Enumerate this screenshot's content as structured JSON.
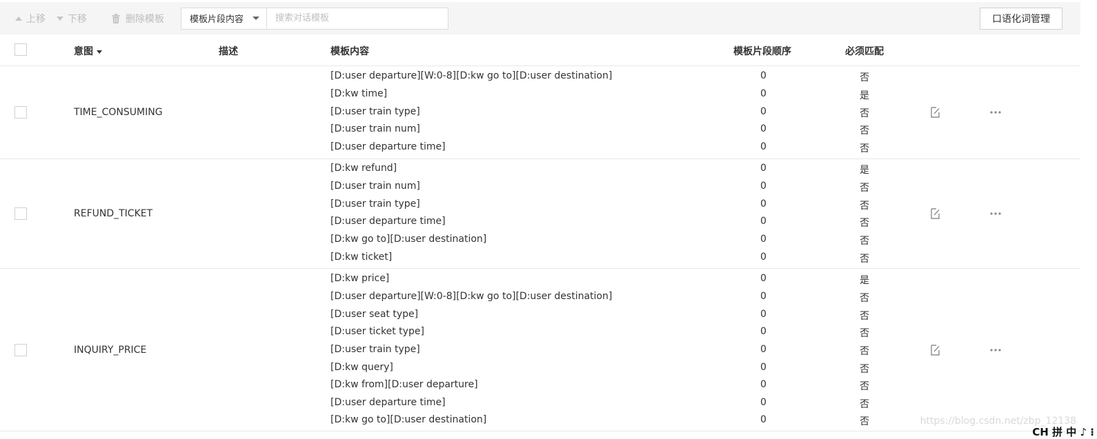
{
  "toolbar": {
    "up_label": "上移",
    "down_label": "下移",
    "delete_label": "删除模板",
    "search_field_selected": "模板片段内容",
    "search_placeholder": "搜索对话模板",
    "oral_button": "口语化词管理"
  },
  "table": {
    "headers": {
      "intent": "意图",
      "description": "描述",
      "content": "模板内容",
      "order": "模板片段顺序",
      "must_match": "必须匹配"
    },
    "groups": [
      {
        "intent": "TIME_CONSUMING",
        "segments": [
          {
            "content": "[D:user departure][W:0-8][D:kw go to][D:user destination]",
            "order": "0",
            "must": "否"
          },
          {
            "content": "[D:kw time]",
            "order": "0",
            "must": "是"
          },
          {
            "content": "[D:user train type]",
            "order": "0",
            "must": "否"
          },
          {
            "content": "[D:user train num]",
            "order": "0",
            "must": "否"
          },
          {
            "content": "[D:user departure time]",
            "order": "0",
            "must": "否"
          }
        ]
      },
      {
        "intent": "REFUND_TICKET",
        "segments": [
          {
            "content": "[D:kw refund]",
            "order": "0",
            "must": "是"
          },
          {
            "content": "[D:user train num]",
            "order": "0",
            "must": "否"
          },
          {
            "content": "[D:user train type]",
            "order": "0",
            "must": "否"
          },
          {
            "content": "[D:user departure time]",
            "order": "0",
            "must": "否"
          },
          {
            "content": "[D:kw go to][D:user destination]",
            "order": "0",
            "must": "否"
          },
          {
            "content": "[D:kw ticket]",
            "order": "0",
            "must": "否"
          }
        ]
      },
      {
        "intent": "INQUIRY_PRICE",
        "segments": [
          {
            "content": "[D:kw price]",
            "order": "0",
            "must": "是"
          },
          {
            "content": "[D:user departure][W:0-8][D:kw go to][D:user destination]",
            "order": "0",
            "must": "否"
          },
          {
            "content": "[D:user seat type]",
            "order": "0",
            "must": "否"
          },
          {
            "content": "[D:user ticket type]",
            "order": "0",
            "must": "否"
          },
          {
            "content": "[D:user train type]",
            "order": "0",
            "must": "否"
          },
          {
            "content": "[D:kw query]",
            "order": "0",
            "must": "否"
          },
          {
            "content": "[D:kw from][D:user departure]",
            "order": "0",
            "must": "否"
          },
          {
            "content": "[D:user departure time]",
            "order": "0",
            "must": "否"
          },
          {
            "content": "[D:kw go to][D:user destination]",
            "order": "0",
            "must": "否"
          }
        ]
      }
    ]
  },
  "watermark": "https://blog.csdn.net/zbp_12138",
  "ime_bar": "CH 拼 中 ♪ ⁝"
}
